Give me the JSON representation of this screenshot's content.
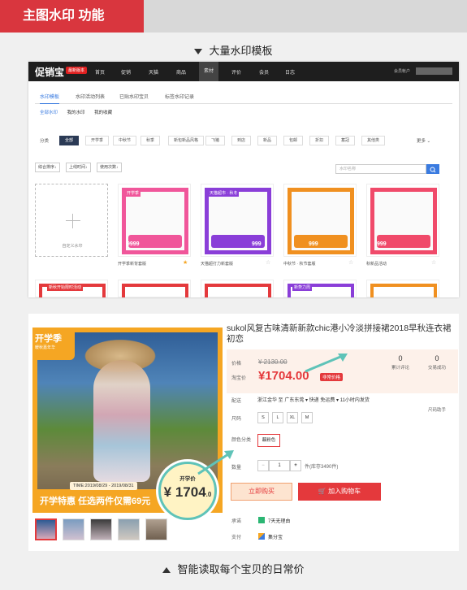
{
  "header": {
    "title": "主图水印 功能"
  },
  "section1": {
    "title": "大量水印模板"
  },
  "section2": {
    "title": "智能读取每个宝贝的日常价"
  },
  "app": {
    "logo": "促销宝",
    "logo_badge": "最新版本",
    "nav": [
      "首页",
      "促销",
      "天猫",
      "商品",
      "素材",
      "评价",
      "会员",
      "日志"
    ],
    "nav_active_index": 4,
    "user": "会员帐户",
    "subtabs": [
      "水印模板",
      "水印活动列表",
      "已贴水印宝贝",
      "标签水印记录"
    ],
    "subtabs2": [
      "全部水印",
      "我的水印",
      "我的收藏"
    ],
    "filter_label": "分类",
    "chips": [
      "全部",
      "开学季",
      "中秋节",
      "秋季",
      "新包新品风格",
      "飞猪",
      "到店",
      "新品",
      "包邮",
      "折扣",
      "蓄冠",
      "其他类"
    ],
    "more": "更多",
    "sort": [
      "综合排序↓",
      "上线时间↓",
      "使用次数↓"
    ],
    "search_placeholder": "水印名称",
    "add_label": "自定义水印",
    "cards": [
      {
        "label": "开学季新背套版",
        "frame_color": "#f0569a",
        "tag": "开学季",
        "price": "9999",
        "starred": true
      },
      {
        "label": "天猫超打力新套版",
        "frame_color": "#8a3ed8",
        "tag": "天猫超市 · 秋冬",
        "price": "999",
        "starred": false
      },
      {
        "label": "中秋节 · 秋节套版",
        "frame_color": "#f09020",
        "tag": "",
        "price": "999",
        "starred": false
      },
      {
        "label": "秋新品活动",
        "frame_color": "#f04a6a",
        "tag": "",
        "price": "999",
        "starred": false
      }
    ],
    "row2_tags": [
      "新秋开始限时活动",
      "",
      "新势力周",
      ""
    ]
  },
  "product": {
    "title": "sukol风复古味清新新款chic港小冷淡拼接裙2018早秋连衣裙初恋",
    "watermark_top": "开学季",
    "watermark_top_sub": "暖秋嘉年华",
    "date": "TIME:2019/08/29 - 2019/08/31",
    "bar_text": "开学特惠  任选两件仅需69元",
    "badge_label": "开学价",
    "badge_price": "1704",
    "badge_sub": ".0",
    "price_label": "价格",
    "price_old": "¥ 2130.00",
    "taobao_label": "淘宝价",
    "price_new": "¥1704.00",
    "pill": "非常价格",
    "review_count": "0",
    "review_label": "累计评论",
    "trade_count": "0",
    "trade_label": "交易成功",
    "delivery_label": "配送",
    "delivery": "浙江金华 至 广东东莞 ▾  快递 免运费 ▾  11小时内发货",
    "size_label": "尺码",
    "size_help": "尺码助手",
    "sizes": [
      "S",
      "L",
      "XL",
      "M"
    ],
    "color_label": "颜色分类",
    "color": "藕粉色",
    "qty_label": "数量",
    "qty": "1",
    "stock": "件(库存3490件)",
    "buy": "立即购买",
    "cart": "加入购物车",
    "promise_label": "承诺",
    "promise": "7天无理由",
    "pay_label": "支付",
    "pay": "集分宝"
  }
}
